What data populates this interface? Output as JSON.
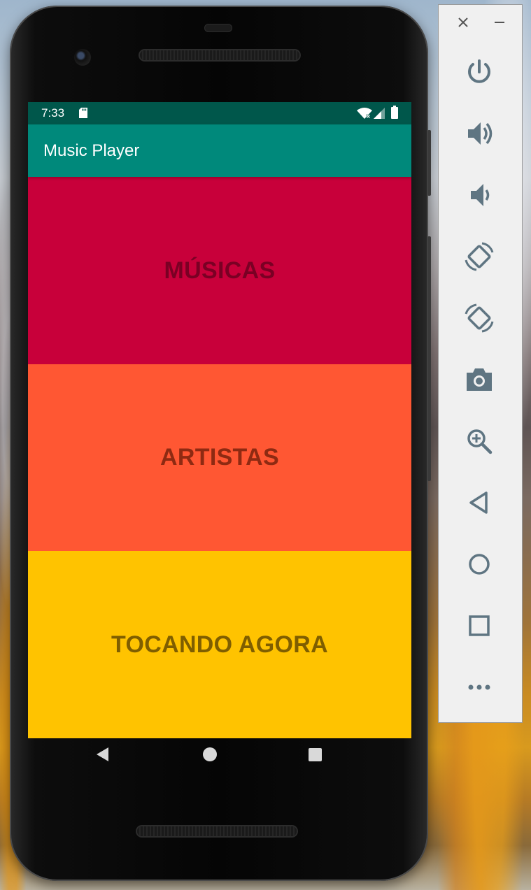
{
  "status_bar": {
    "time": "7:33"
  },
  "app_bar": {
    "title": "Music Player"
  },
  "tiles": [
    {
      "label": "MÚSICAS",
      "color": "#c8003a"
    },
    {
      "label": "ARTISTAS",
      "color": "#ff5733"
    },
    {
      "label": "TOCANDO AGORA",
      "color": "#ffc300"
    }
  ],
  "theme": {
    "status_bar_color": "#00574b",
    "app_bar_color": "#00897b"
  },
  "navigation_bar": {
    "buttons": [
      "back-icon",
      "home-icon",
      "recents-icon"
    ]
  },
  "emulator_panel": {
    "window_controls": [
      "close-icon",
      "minimize-icon"
    ],
    "buttons": [
      "power-icon",
      "volume-up-icon",
      "volume-down-icon",
      "rotate-left-icon",
      "rotate-right-icon",
      "camera-icon",
      "zoom-icon",
      "back-icon",
      "home-icon",
      "overview-icon",
      "more-icon"
    ]
  }
}
